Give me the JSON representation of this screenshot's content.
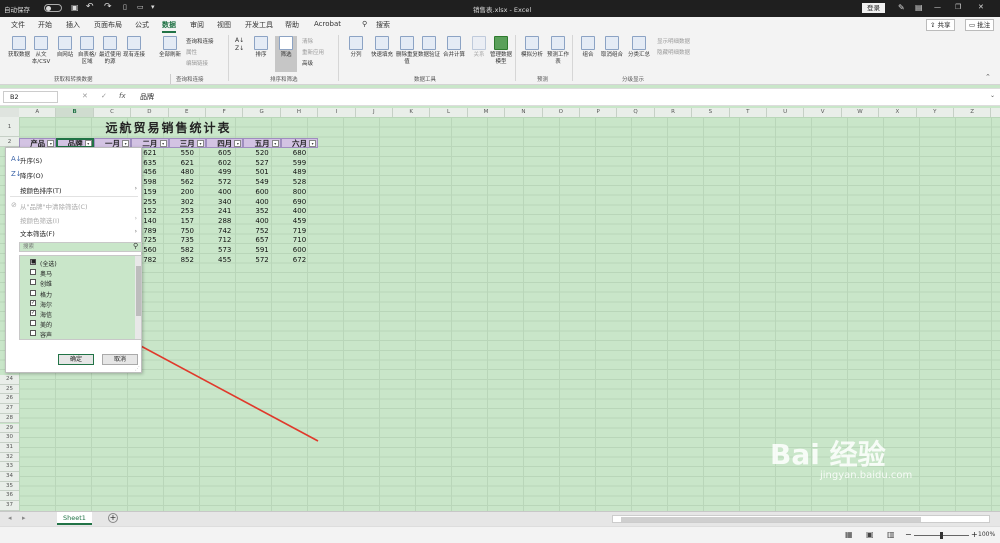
{
  "titlebar": {
    "autosave_label": "自动保存",
    "file_name": "销售表.xlsx - Excel",
    "login_label": "登录",
    "min_glyph": "—",
    "max_glyph": "❐",
    "close_glyph": "✕"
  },
  "tabs": {
    "items": [
      "文件",
      "开始",
      "插入",
      "页面布局",
      "公式",
      "数据",
      "审阅",
      "视图",
      "开发工具",
      "帮助",
      "Acrobat"
    ],
    "search_label": "搜索",
    "share_label": "共享",
    "comment_label": "批注",
    "active": "数据"
  },
  "ribbon": {
    "buttons": [
      "获取数据",
      "从文本/CSV",
      "自网站",
      "自表格/区域",
      "最近使用的源",
      "现有连接",
      "全部刷新",
      "排序",
      "筛选",
      "分列",
      "快速填充",
      "删除重复值",
      "数据验证",
      "合并计算",
      "关系",
      "管理数据模型",
      "模拟分析",
      "预测工作表",
      "组合",
      "取消组合",
      "分类汇总"
    ],
    "small_items": [
      "查询和连接",
      "属性",
      "编辑链接",
      "清除",
      "重新应用",
      "高级",
      "显示明细数据",
      "隐藏明细数据"
    ],
    "group_labels": [
      "获取和转换数据",
      "查询和连接",
      "排序和筛选",
      "数据工具",
      "预测",
      "分级显示"
    ]
  },
  "formula": {
    "namebox": "B2",
    "fx": "fx",
    "value": "品牌",
    "cancel": "✕",
    "enter": "✓"
  },
  "columns": [
    "A",
    "B",
    "C",
    "D",
    "E",
    "F",
    "G",
    "H",
    "I",
    "J",
    "K",
    "L",
    "M",
    "N",
    "O",
    "P",
    "Q",
    "R",
    "S",
    "T",
    "U",
    "V",
    "W",
    "X",
    "Y",
    "Z",
    "AA"
  ],
  "rows_top": [
    "1",
    "2"
  ],
  "rows_bottom": [
    "24",
    "25",
    "26",
    "27",
    "28",
    "29",
    "30",
    "31",
    "32",
    "33",
    "34",
    "35",
    "36",
    "37",
    "38"
  ],
  "sheet": {
    "title": "远航贸易销售统计表",
    "headers": [
      "产品",
      "品牌",
      "一月",
      "二月",
      "三月",
      "四月",
      "五月",
      "六月"
    ],
    "values": [
      [
        "621",
        "550",
        "605",
        "520",
        "680"
      ],
      [
        "635",
        "621",
        "602",
        "527",
        "599"
      ],
      [
        "456",
        "480",
        "499",
        "501",
        "489"
      ],
      [
        "598",
        "562",
        "572",
        "549",
        "528"
      ],
      [
        "159",
        "200",
        "400",
        "600",
        "800"
      ],
      [
        "255",
        "302",
        "340",
        "400",
        "690"
      ],
      [
        "152",
        "253",
        "241",
        "352",
        "400"
      ],
      [
        "140",
        "157",
        "288",
        "400",
        "459"
      ],
      [
        "789",
        "750",
        "742",
        "752",
        "719"
      ],
      [
        "725",
        "735",
        "712",
        "657",
        "710"
      ],
      [
        "560",
        "582",
        "573",
        "591",
        "600"
      ],
      [
        "782",
        "852",
        "455",
        "572",
        "672"
      ]
    ]
  },
  "filter_popup": {
    "sort_asc": "升序(S)",
    "sort_desc": "降序(O)",
    "sort_color": "按颜色排序(T)",
    "clear": "从\"品牌\"中清除筛选(C)",
    "filter_color": "按颜色筛选(I)",
    "text_filter": "文本筛选(F)",
    "search_placeholder": "搜索",
    "items": [
      {
        "label": "(全选)",
        "state": "partial"
      },
      {
        "label": "奥马",
        "state": "off"
      },
      {
        "label": "创维",
        "state": "off"
      },
      {
        "label": "格力",
        "state": "off"
      },
      {
        "label": "海尔",
        "state": "on"
      },
      {
        "label": "海信",
        "state": "on"
      },
      {
        "label": "美的",
        "state": "off"
      },
      {
        "label": "容声",
        "state": "off"
      }
    ],
    "ok": "确定",
    "cancel": "取消"
  },
  "sheettabs": {
    "sheet_name": "Sheet1",
    "add": "+"
  },
  "status": {
    "zoom": "100%",
    "minus": "−",
    "plus": "+"
  },
  "watermark": {
    "text": "Bai 经验",
    "url": "jingyan.baidu.com"
  },
  "colors": {
    "accent": "#217346",
    "sheet_bg": "#c9e6c9",
    "header_fill": "#d3c3e3",
    "arrow": "#e0392b"
  }
}
